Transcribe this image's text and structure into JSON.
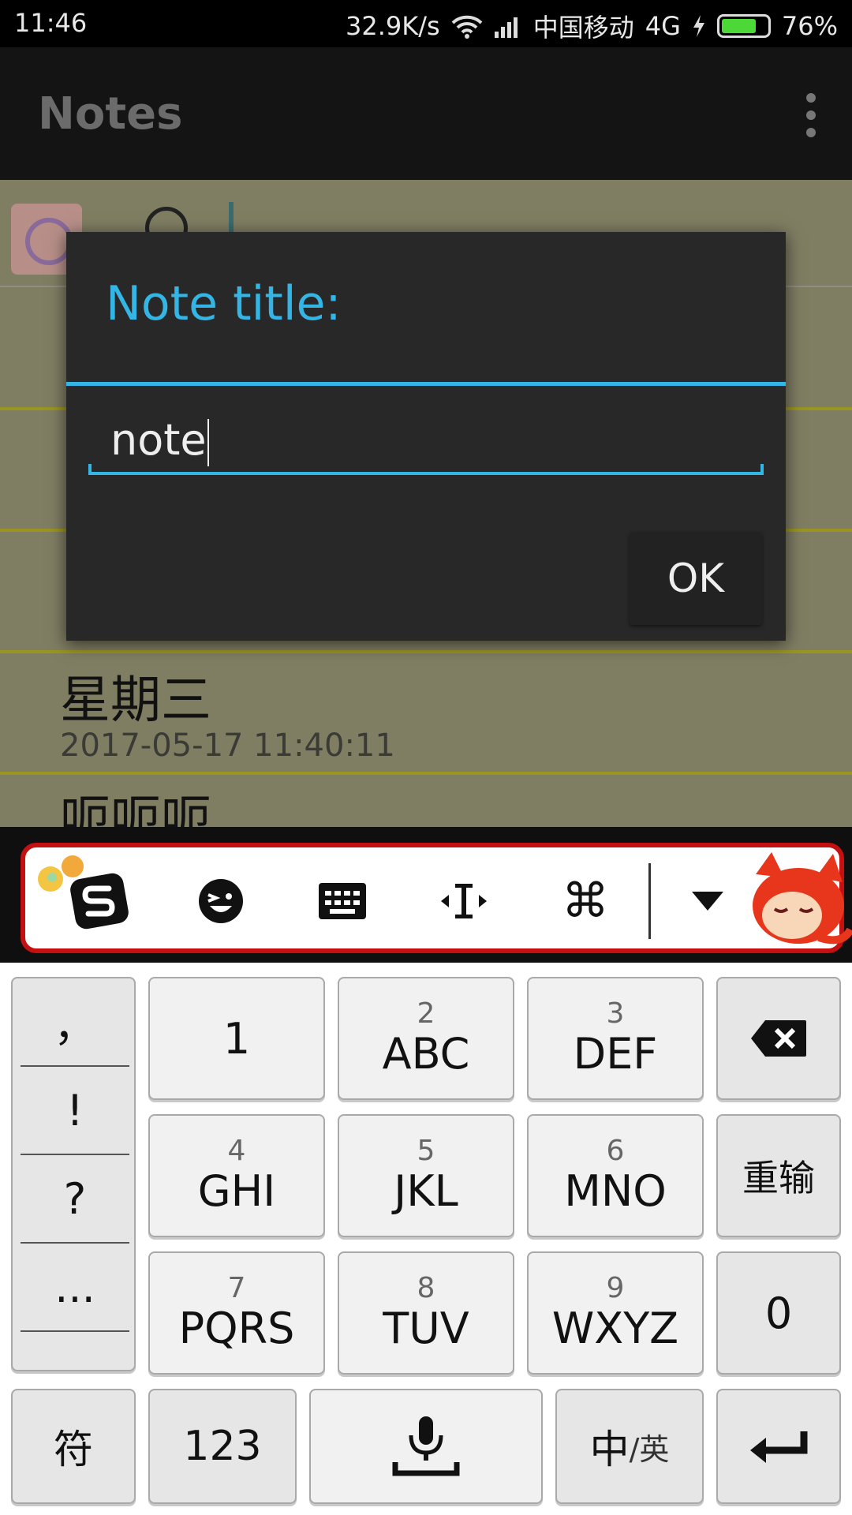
{
  "status_bar": {
    "time": "11:46",
    "speed": "32.9K/s",
    "carrier": "中国移动",
    "network": "4G",
    "battery_percent": "76%",
    "battery_level": 0.76,
    "icons": [
      "wifi-icon",
      "signal-icon",
      "charging-icon",
      "battery-icon"
    ]
  },
  "action_bar": {
    "title": "Notes",
    "overflow_icon": "overflow-menu-icon"
  },
  "notes_list": {
    "items": [
      {
        "title": "",
        "date": ""
      },
      {
        "title": "",
        "date": ""
      },
      {
        "title": "",
        "date": ""
      },
      {
        "title": "星期三",
        "date": "2017-05-17 11:40:11"
      },
      {
        "title": "呃呃呃",
        "date": ""
      }
    ]
  },
  "dialog": {
    "title": "Note title:",
    "input_value": "note",
    "ok_label": "OK"
  },
  "ime_toolbar": {
    "buttons": [
      "sogou-logo-icon",
      "emoji-icon",
      "keyboard-icon",
      "cursor-move-icon",
      "command-icon",
      "collapse-arrow-icon"
    ]
  },
  "keyboard": {
    "punctuation": [
      "，",
      "!",
      "?",
      "..."
    ],
    "keys_row1": [
      {
        "num": "",
        "letters": "1"
      },
      {
        "num": "2",
        "letters": "ABC"
      },
      {
        "num": "3",
        "letters": "DEF"
      }
    ],
    "keys_row2": [
      {
        "num": "4",
        "letters": "GHI"
      },
      {
        "num": "5",
        "letters": "JKL"
      },
      {
        "num": "6",
        "letters": "MNO"
      }
    ],
    "keys_row3": [
      {
        "num": "7",
        "letters": "PQRS"
      },
      {
        "num": "8",
        "letters": "TUV"
      },
      {
        "num": "9",
        "letters": "WXYZ"
      }
    ],
    "retype_label": "重输",
    "zero_label": "0",
    "symbol_label": "符",
    "num_label": "123",
    "lang_zh": "中",
    "lang_en": "/英"
  },
  "colors": {
    "accent": "#33b5e5",
    "dialog_bg": "#282828",
    "ime_border": "#c41010",
    "battery_green": "#4cd937"
  }
}
